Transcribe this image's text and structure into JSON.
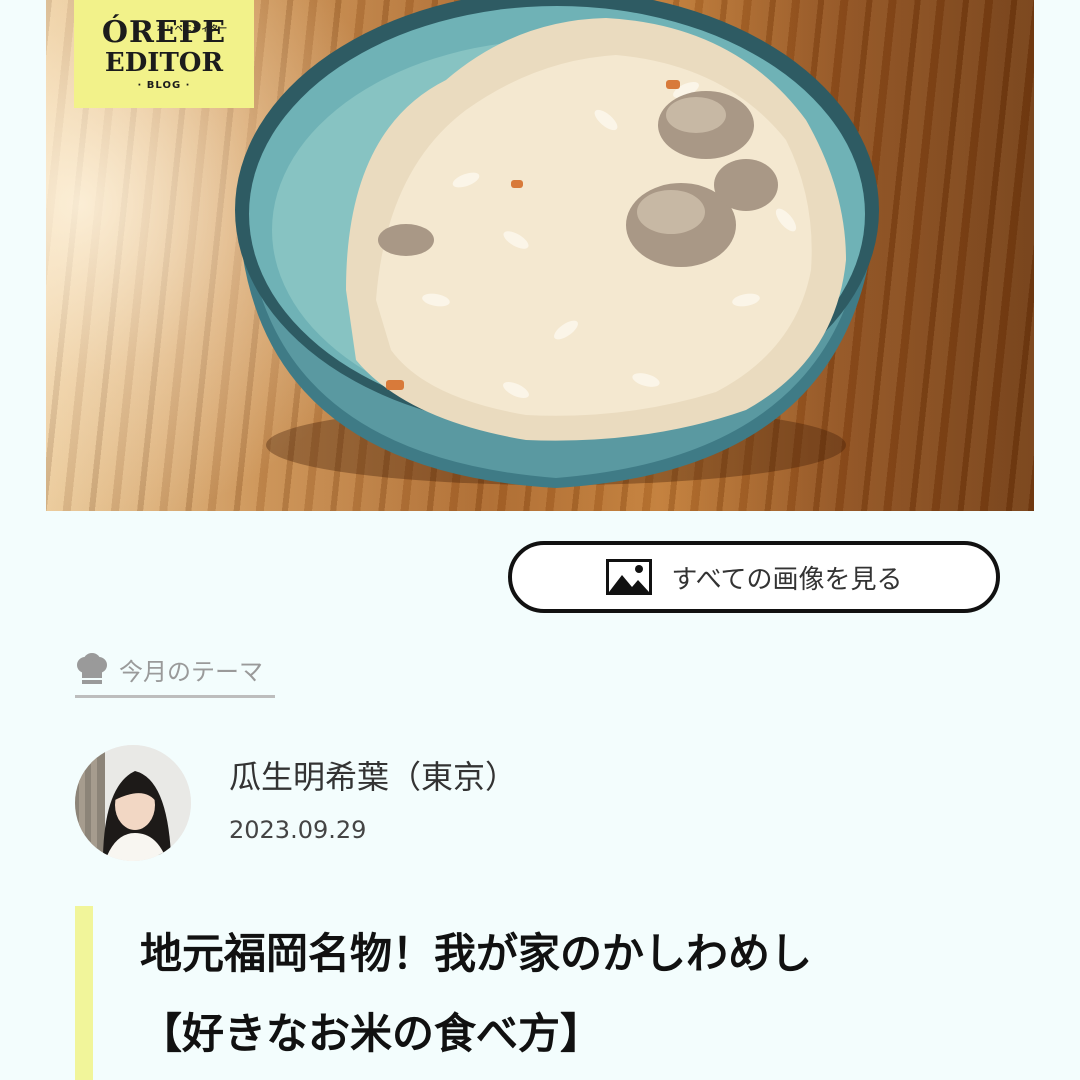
{
  "brand": {
    "logo_line1": "ÓREPE",
    "logo_kana": "オレペエディター",
    "logo_line2": "EDITOR",
    "logo_line3": "· BLOG ·"
  },
  "gallery": {
    "view_all_label": "すべての画像を見る",
    "icon": "image-icon"
  },
  "theme": {
    "label": "今月のテーマ",
    "icon": "chef-hat-icon"
  },
  "author": {
    "name": "瓜生明希葉（東京）",
    "date": "2023.09.29"
  },
  "article": {
    "title_line1": "地元福岡名物！我が家のかしわめし",
    "title_line2": "【好きなお米の食べ方】"
  },
  "colors": {
    "background": "#f3fdfd",
    "logo_bg": "#f2f28a",
    "title_accent": "#f1f59a",
    "button_border": "#111111"
  }
}
